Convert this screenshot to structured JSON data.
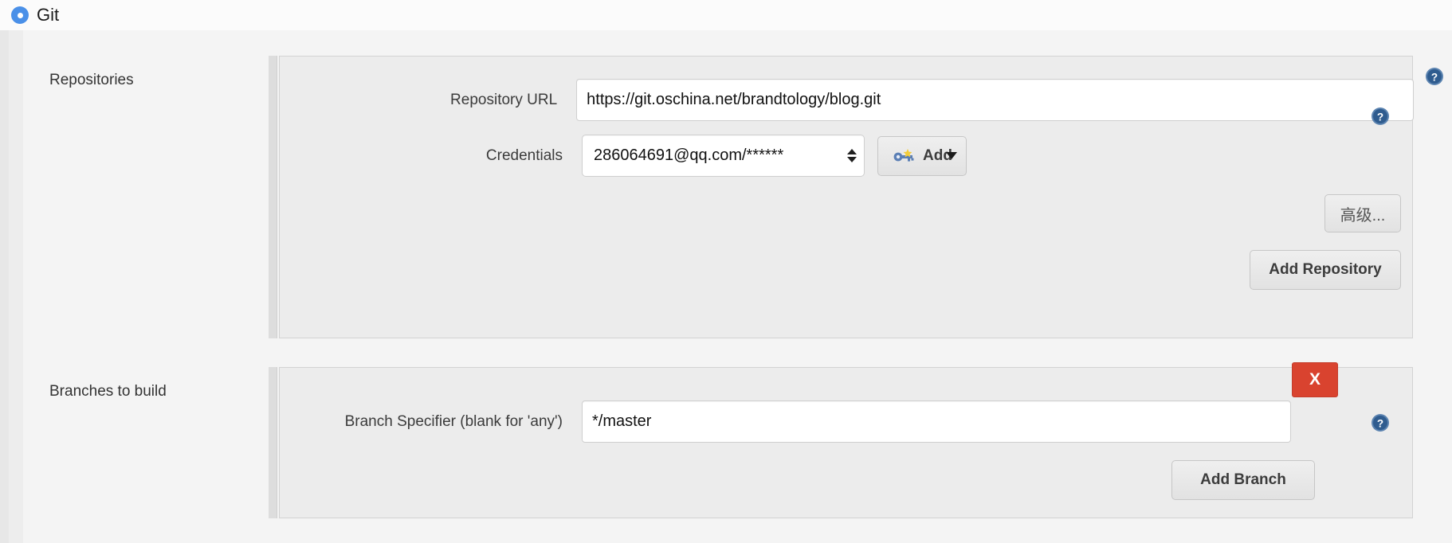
{
  "scm": {
    "selected_label": "Git",
    "radio_color": "#4a90e8"
  },
  "sections": [
    {
      "title": "Repositories",
      "fields": [
        {
          "label": "Repository URL",
          "value": "https://git.oschina.net/brandtology/blog.git",
          "placeholder": ""
        },
        {
          "label": "Credentials",
          "value": "286064691@qq.com/******"
        }
      ],
      "buttons": {
        "add_credentials": "Add",
        "advanced": "高级...",
        "add_repository": "Add Repository"
      }
    },
    {
      "title": "Branches to build",
      "fields": [
        {
          "label": "Branch Specifier (blank for 'any')",
          "value": "*/master",
          "placeholder": ""
        }
      ],
      "buttons": {
        "delete": "X",
        "add_branch": "Add Branch"
      }
    }
  ],
  "icons": {
    "help": "help-icon",
    "key": "key-icon",
    "radio": "radio-selected-icon",
    "delete": "delete-x-icon"
  },
  "colors": {
    "danger": "#d9432f",
    "accent": "#4a90e8",
    "panel_bg": "#ececec",
    "page_bg": "#f4f4f4"
  }
}
